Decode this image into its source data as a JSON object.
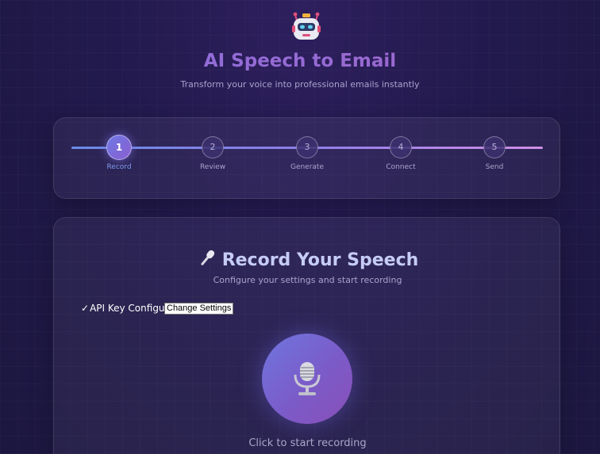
{
  "header": {
    "logo_icon": "robot-icon",
    "title": "AI Speech to Email",
    "subtitle": "Transform your voice into professional emails instantly"
  },
  "progress": {
    "active_step": 1,
    "steps": [
      {
        "number": "1",
        "label": "Record"
      },
      {
        "number": "2",
        "label": "Review"
      },
      {
        "number": "3",
        "label": "Generate"
      },
      {
        "number": "4",
        "label": "Connect"
      },
      {
        "number": "5",
        "label": "Send"
      }
    ]
  },
  "record": {
    "title_icon": "microphone-icon",
    "title": "Record Your Speech",
    "subtitle": "Configure your settings and start recording",
    "api_status_check": "✓",
    "api_status_text": "API Key Configured",
    "change_settings_label": "Change Settings",
    "record_button_icon": "studio-microphone-icon",
    "hint": "Click to start recording"
  },
  "colors": {
    "accent_blue": "#6e78e6",
    "accent_purple": "#8a5fcf",
    "title_gradient_start": "#8b6fe0",
    "title_gradient_end": "#a066c8",
    "background": "#221a4d"
  }
}
